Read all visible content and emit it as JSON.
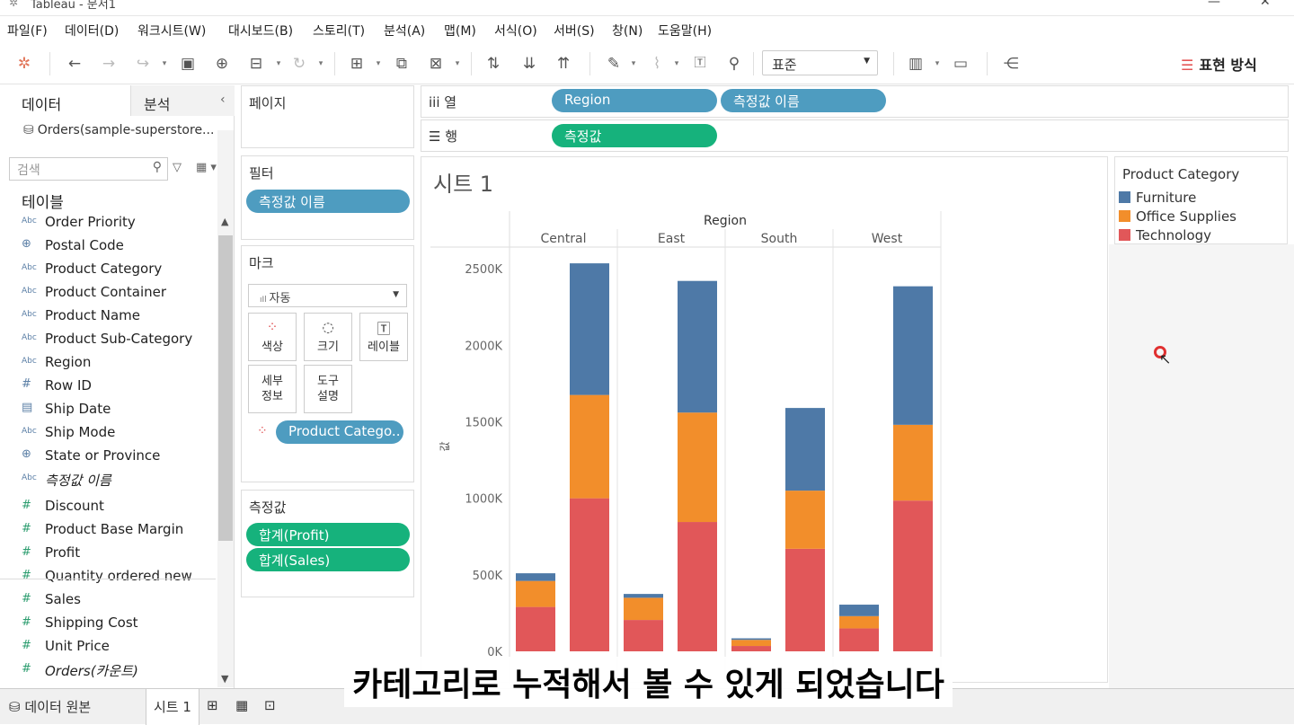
{
  "window": {
    "title": "Tableau - 문서1"
  },
  "menu": [
    "파일(F)",
    "데이터(D)",
    "워크시트(W)",
    "대시보드(B)",
    "스토리(T)",
    "분석(A)",
    "맵(M)",
    "서식(O)",
    "서버(S)",
    "창(N)",
    "도움말(H)"
  ],
  "toolbar": {
    "fit_value": "표준",
    "show_me": "표현 방식"
  },
  "data_pane": {
    "tab_data": "데이터",
    "tab_analysis": "분석",
    "source": "Orders(sample-superstore...",
    "search_placeholder": "검색",
    "tables_heading": "테이블",
    "dimensions": [
      {
        "type": "Abc",
        "name": "Order Priority"
      },
      {
        "type": "geo",
        "name": "Postal Code"
      },
      {
        "type": "Abc",
        "name": "Product Category"
      },
      {
        "type": "Abc",
        "name": "Product Container"
      },
      {
        "type": "Abc",
        "name": "Product Name"
      },
      {
        "type": "Abc",
        "name": "Product Sub-Category"
      },
      {
        "type": "Abc",
        "name": "Region"
      },
      {
        "type": "#",
        "name": "Row ID"
      },
      {
        "type": "date",
        "name": "Ship Date"
      },
      {
        "type": "Abc",
        "name": "Ship Mode"
      },
      {
        "type": "geo",
        "name": "State or Province"
      },
      {
        "type": "Abc",
        "name": "측정값 이름",
        "italic": true
      }
    ],
    "measures": [
      {
        "type": "#",
        "name": "Discount"
      },
      {
        "type": "#",
        "name": "Product Base Margin"
      },
      {
        "type": "#",
        "name": "Profit"
      },
      {
        "type": "#",
        "name": "Quantity ordered new"
      },
      {
        "type": "#",
        "name": "Sales"
      },
      {
        "type": "#",
        "name": "Shipping Cost"
      },
      {
        "type": "#",
        "name": "Unit Price"
      },
      {
        "type": "=",
        "name": "Orders(카운트)",
        "italic": true
      }
    ]
  },
  "shelves": {
    "pages_label": "페이지",
    "filters_label": "필터",
    "filter_pill": "측정값 이름",
    "marks_label": "마크",
    "mark_type": "자동",
    "mark_buttons": [
      "색상",
      "크기",
      "레이블",
      "세부\n정보",
      "도구\n설명"
    ],
    "color_pill": "Product Catego..",
    "measure_values_label": "측정값",
    "measure_pills": [
      "합계(Profit)",
      "합계(Sales)"
    ],
    "columns_label": "열",
    "columns_pills": [
      "Region",
      "측정값 이름"
    ],
    "rows_label": "행",
    "rows_pill": "측정값"
  },
  "sheet": {
    "title": "시트 1",
    "y_axis_label": "값"
  },
  "chart_data": {
    "type": "bar",
    "stacked": true,
    "header": "Region",
    "categories": [
      "Central",
      "East",
      "South",
      "West"
    ],
    "bars_per_category": [
      "Profit",
      "Sales"
    ],
    "ylim": [
      0,
      2700000
    ],
    "yticks": [
      0,
      500000,
      1000000,
      1500000,
      2000000,
      2500000
    ],
    "ytick_labels": [
      "0K",
      "500K",
      "1000K",
      "1500K",
      "2000K",
      "2500K"
    ],
    "series": [
      {
        "name": "Technology",
        "color": "#e15759",
        "values": {
          "Central": [
            290000,
            1000000
          ],
          "East": [
            205000,
            845000
          ],
          "South": [
            35000,
            670000
          ],
          "West": [
            150000,
            985000
          ]
        }
      },
      {
        "name": "Office Supplies",
        "color": "#f28e2b",
        "values": {
          "Central": [
            170000,
            675000
          ],
          "East": [
            145000,
            715000
          ],
          "South": [
            40000,
            380000
          ],
          "West": [
            80000,
            495000
          ]
        }
      },
      {
        "name": "Furniture",
        "color": "#4e79a7",
        "values": {
          "Central": [
            50000,
            860000
          ],
          "East": [
            25000,
            860000
          ],
          "South": [
            10000,
            540000
          ],
          "West": [
            75000,
            905000
          ]
        }
      }
    ]
  },
  "legend": {
    "title": "Product Category",
    "items": [
      {
        "label": "Furniture",
        "color": "#4e79a7"
      },
      {
        "label": "Office Supplies",
        "color": "#f28e2b"
      },
      {
        "label": "Technology",
        "color": "#e15759"
      }
    ]
  },
  "bottom_tabs": {
    "data_source": "데이터 원본",
    "sheet1": "시트 1"
  },
  "subtitle": "카테고리로 누적해서 볼 수 있게 되었습니다"
}
